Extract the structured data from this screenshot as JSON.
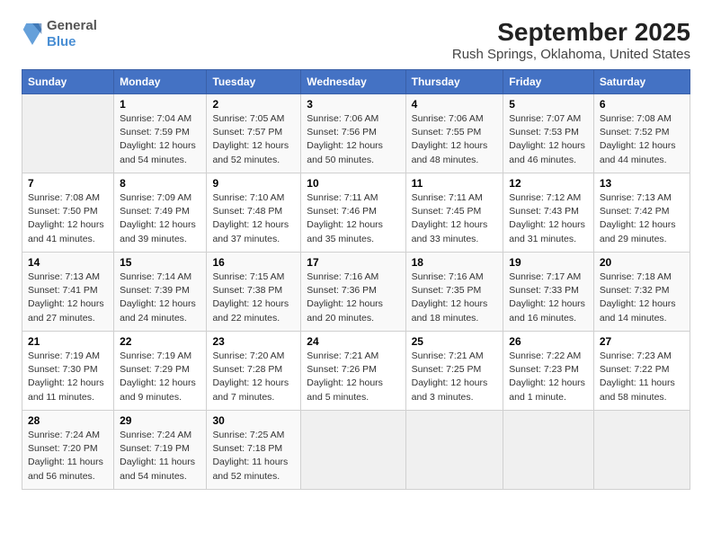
{
  "logo": {
    "line1": "General",
    "line2": "Blue"
  },
  "title": "September 2025",
  "subtitle": "Rush Springs, Oklahoma, United States",
  "days_of_week": [
    "Sunday",
    "Monday",
    "Tuesday",
    "Wednesday",
    "Thursday",
    "Friday",
    "Saturday"
  ],
  "weeks": [
    [
      {
        "day": "",
        "empty": true
      },
      {
        "day": "1",
        "sunrise": "Sunrise: 7:04 AM",
        "sunset": "Sunset: 7:59 PM",
        "daylight": "Daylight: 12 hours and 54 minutes."
      },
      {
        "day": "2",
        "sunrise": "Sunrise: 7:05 AM",
        "sunset": "Sunset: 7:57 PM",
        "daylight": "Daylight: 12 hours and 52 minutes."
      },
      {
        "day": "3",
        "sunrise": "Sunrise: 7:06 AM",
        "sunset": "Sunset: 7:56 PM",
        "daylight": "Daylight: 12 hours and 50 minutes."
      },
      {
        "day": "4",
        "sunrise": "Sunrise: 7:06 AM",
        "sunset": "Sunset: 7:55 PM",
        "daylight": "Daylight: 12 hours and 48 minutes."
      },
      {
        "day": "5",
        "sunrise": "Sunrise: 7:07 AM",
        "sunset": "Sunset: 7:53 PM",
        "daylight": "Daylight: 12 hours and 46 minutes."
      },
      {
        "day": "6",
        "sunrise": "Sunrise: 7:08 AM",
        "sunset": "Sunset: 7:52 PM",
        "daylight": "Daylight: 12 hours and 44 minutes."
      }
    ],
    [
      {
        "day": "7",
        "sunrise": "Sunrise: 7:08 AM",
        "sunset": "Sunset: 7:50 PM",
        "daylight": "Daylight: 12 hours and 41 minutes."
      },
      {
        "day": "8",
        "sunrise": "Sunrise: 7:09 AM",
        "sunset": "Sunset: 7:49 PM",
        "daylight": "Daylight: 12 hours and 39 minutes."
      },
      {
        "day": "9",
        "sunrise": "Sunrise: 7:10 AM",
        "sunset": "Sunset: 7:48 PM",
        "daylight": "Daylight: 12 hours and 37 minutes."
      },
      {
        "day": "10",
        "sunrise": "Sunrise: 7:11 AM",
        "sunset": "Sunset: 7:46 PM",
        "daylight": "Daylight: 12 hours and 35 minutes."
      },
      {
        "day": "11",
        "sunrise": "Sunrise: 7:11 AM",
        "sunset": "Sunset: 7:45 PM",
        "daylight": "Daylight: 12 hours and 33 minutes."
      },
      {
        "day": "12",
        "sunrise": "Sunrise: 7:12 AM",
        "sunset": "Sunset: 7:43 PM",
        "daylight": "Daylight: 12 hours and 31 minutes."
      },
      {
        "day": "13",
        "sunrise": "Sunrise: 7:13 AM",
        "sunset": "Sunset: 7:42 PM",
        "daylight": "Daylight: 12 hours and 29 minutes."
      }
    ],
    [
      {
        "day": "14",
        "sunrise": "Sunrise: 7:13 AM",
        "sunset": "Sunset: 7:41 PM",
        "daylight": "Daylight: 12 hours and 27 minutes."
      },
      {
        "day": "15",
        "sunrise": "Sunrise: 7:14 AM",
        "sunset": "Sunset: 7:39 PM",
        "daylight": "Daylight: 12 hours and 24 minutes."
      },
      {
        "day": "16",
        "sunrise": "Sunrise: 7:15 AM",
        "sunset": "Sunset: 7:38 PM",
        "daylight": "Daylight: 12 hours and 22 minutes."
      },
      {
        "day": "17",
        "sunrise": "Sunrise: 7:16 AM",
        "sunset": "Sunset: 7:36 PM",
        "daylight": "Daylight: 12 hours and 20 minutes."
      },
      {
        "day": "18",
        "sunrise": "Sunrise: 7:16 AM",
        "sunset": "Sunset: 7:35 PM",
        "daylight": "Daylight: 12 hours and 18 minutes."
      },
      {
        "day": "19",
        "sunrise": "Sunrise: 7:17 AM",
        "sunset": "Sunset: 7:33 PM",
        "daylight": "Daylight: 12 hours and 16 minutes."
      },
      {
        "day": "20",
        "sunrise": "Sunrise: 7:18 AM",
        "sunset": "Sunset: 7:32 PM",
        "daylight": "Daylight: 12 hours and 14 minutes."
      }
    ],
    [
      {
        "day": "21",
        "sunrise": "Sunrise: 7:19 AM",
        "sunset": "Sunset: 7:30 PM",
        "daylight": "Daylight: 12 hours and 11 minutes."
      },
      {
        "day": "22",
        "sunrise": "Sunrise: 7:19 AM",
        "sunset": "Sunset: 7:29 PM",
        "daylight": "Daylight: 12 hours and 9 minutes."
      },
      {
        "day": "23",
        "sunrise": "Sunrise: 7:20 AM",
        "sunset": "Sunset: 7:28 PM",
        "daylight": "Daylight: 12 hours and 7 minutes."
      },
      {
        "day": "24",
        "sunrise": "Sunrise: 7:21 AM",
        "sunset": "Sunset: 7:26 PM",
        "daylight": "Daylight: 12 hours and 5 minutes."
      },
      {
        "day": "25",
        "sunrise": "Sunrise: 7:21 AM",
        "sunset": "Sunset: 7:25 PM",
        "daylight": "Daylight: 12 hours and 3 minutes."
      },
      {
        "day": "26",
        "sunrise": "Sunrise: 7:22 AM",
        "sunset": "Sunset: 7:23 PM",
        "daylight": "Daylight: 12 hours and 1 minute."
      },
      {
        "day": "27",
        "sunrise": "Sunrise: 7:23 AM",
        "sunset": "Sunset: 7:22 PM",
        "daylight": "Daylight: 11 hours and 58 minutes."
      }
    ],
    [
      {
        "day": "28",
        "sunrise": "Sunrise: 7:24 AM",
        "sunset": "Sunset: 7:20 PM",
        "daylight": "Daylight: 11 hours and 56 minutes."
      },
      {
        "day": "29",
        "sunrise": "Sunrise: 7:24 AM",
        "sunset": "Sunset: 7:19 PM",
        "daylight": "Daylight: 11 hours and 54 minutes."
      },
      {
        "day": "30",
        "sunrise": "Sunrise: 7:25 AM",
        "sunset": "Sunset: 7:18 PM",
        "daylight": "Daylight: 11 hours and 52 minutes."
      },
      {
        "day": "",
        "empty": true
      },
      {
        "day": "",
        "empty": true
      },
      {
        "day": "",
        "empty": true
      },
      {
        "day": "",
        "empty": true
      }
    ]
  ]
}
